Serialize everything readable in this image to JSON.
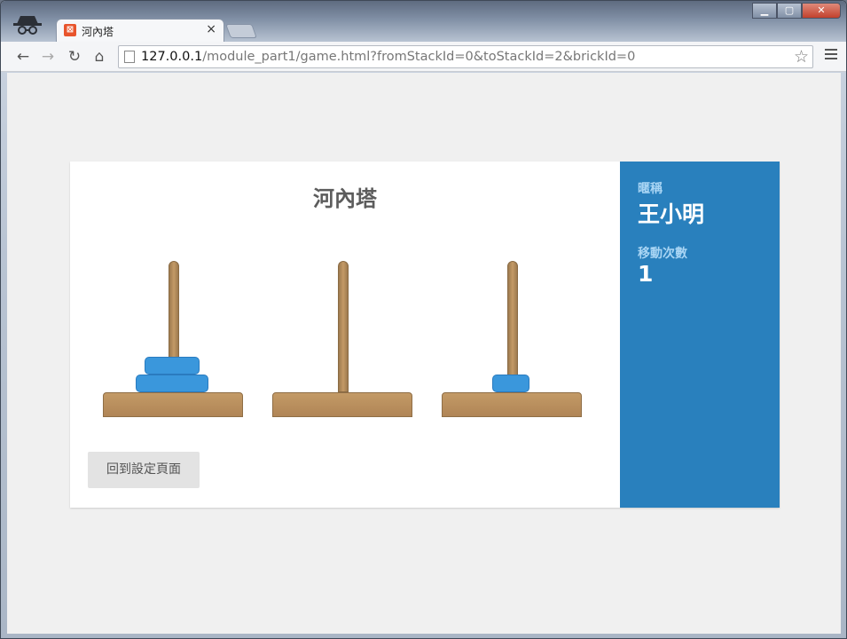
{
  "browser": {
    "tab_title": "河內塔",
    "tab_close": "×",
    "url_host": "127.0.0.1",
    "url_path": "/module_part1/game.html?fromStackId=0&toStackId=2&brickId=0",
    "icons": [
      "incognito-icon",
      "back-arrow-icon",
      "forward-arrow-icon",
      "reload-icon",
      "home-icon",
      "page-icon",
      "star-icon",
      "menu-icon"
    ]
  },
  "game": {
    "title": "河內塔",
    "towers": [
      {
        "id": 0,
        "disks": [
          2,
          3
        ]
      },
      {
        "id": 1,
        "disks": []
      },
      {
        "id": 2,
        "disks": [
          1
        ]
      }
    ],
    "back_button": "回到設定頁面"
  },
  "sidebar": {
    "nickname_label": "暱稱",
    "nickname": "王小明",
    "moves_label": "移動次數",
    "moves": "1"
  },
  "colors": {
    "sidebar_bg": "#2980bd",
    "disk": "#3a97dc",
    "wood": "#b98f5e"
  }
}
